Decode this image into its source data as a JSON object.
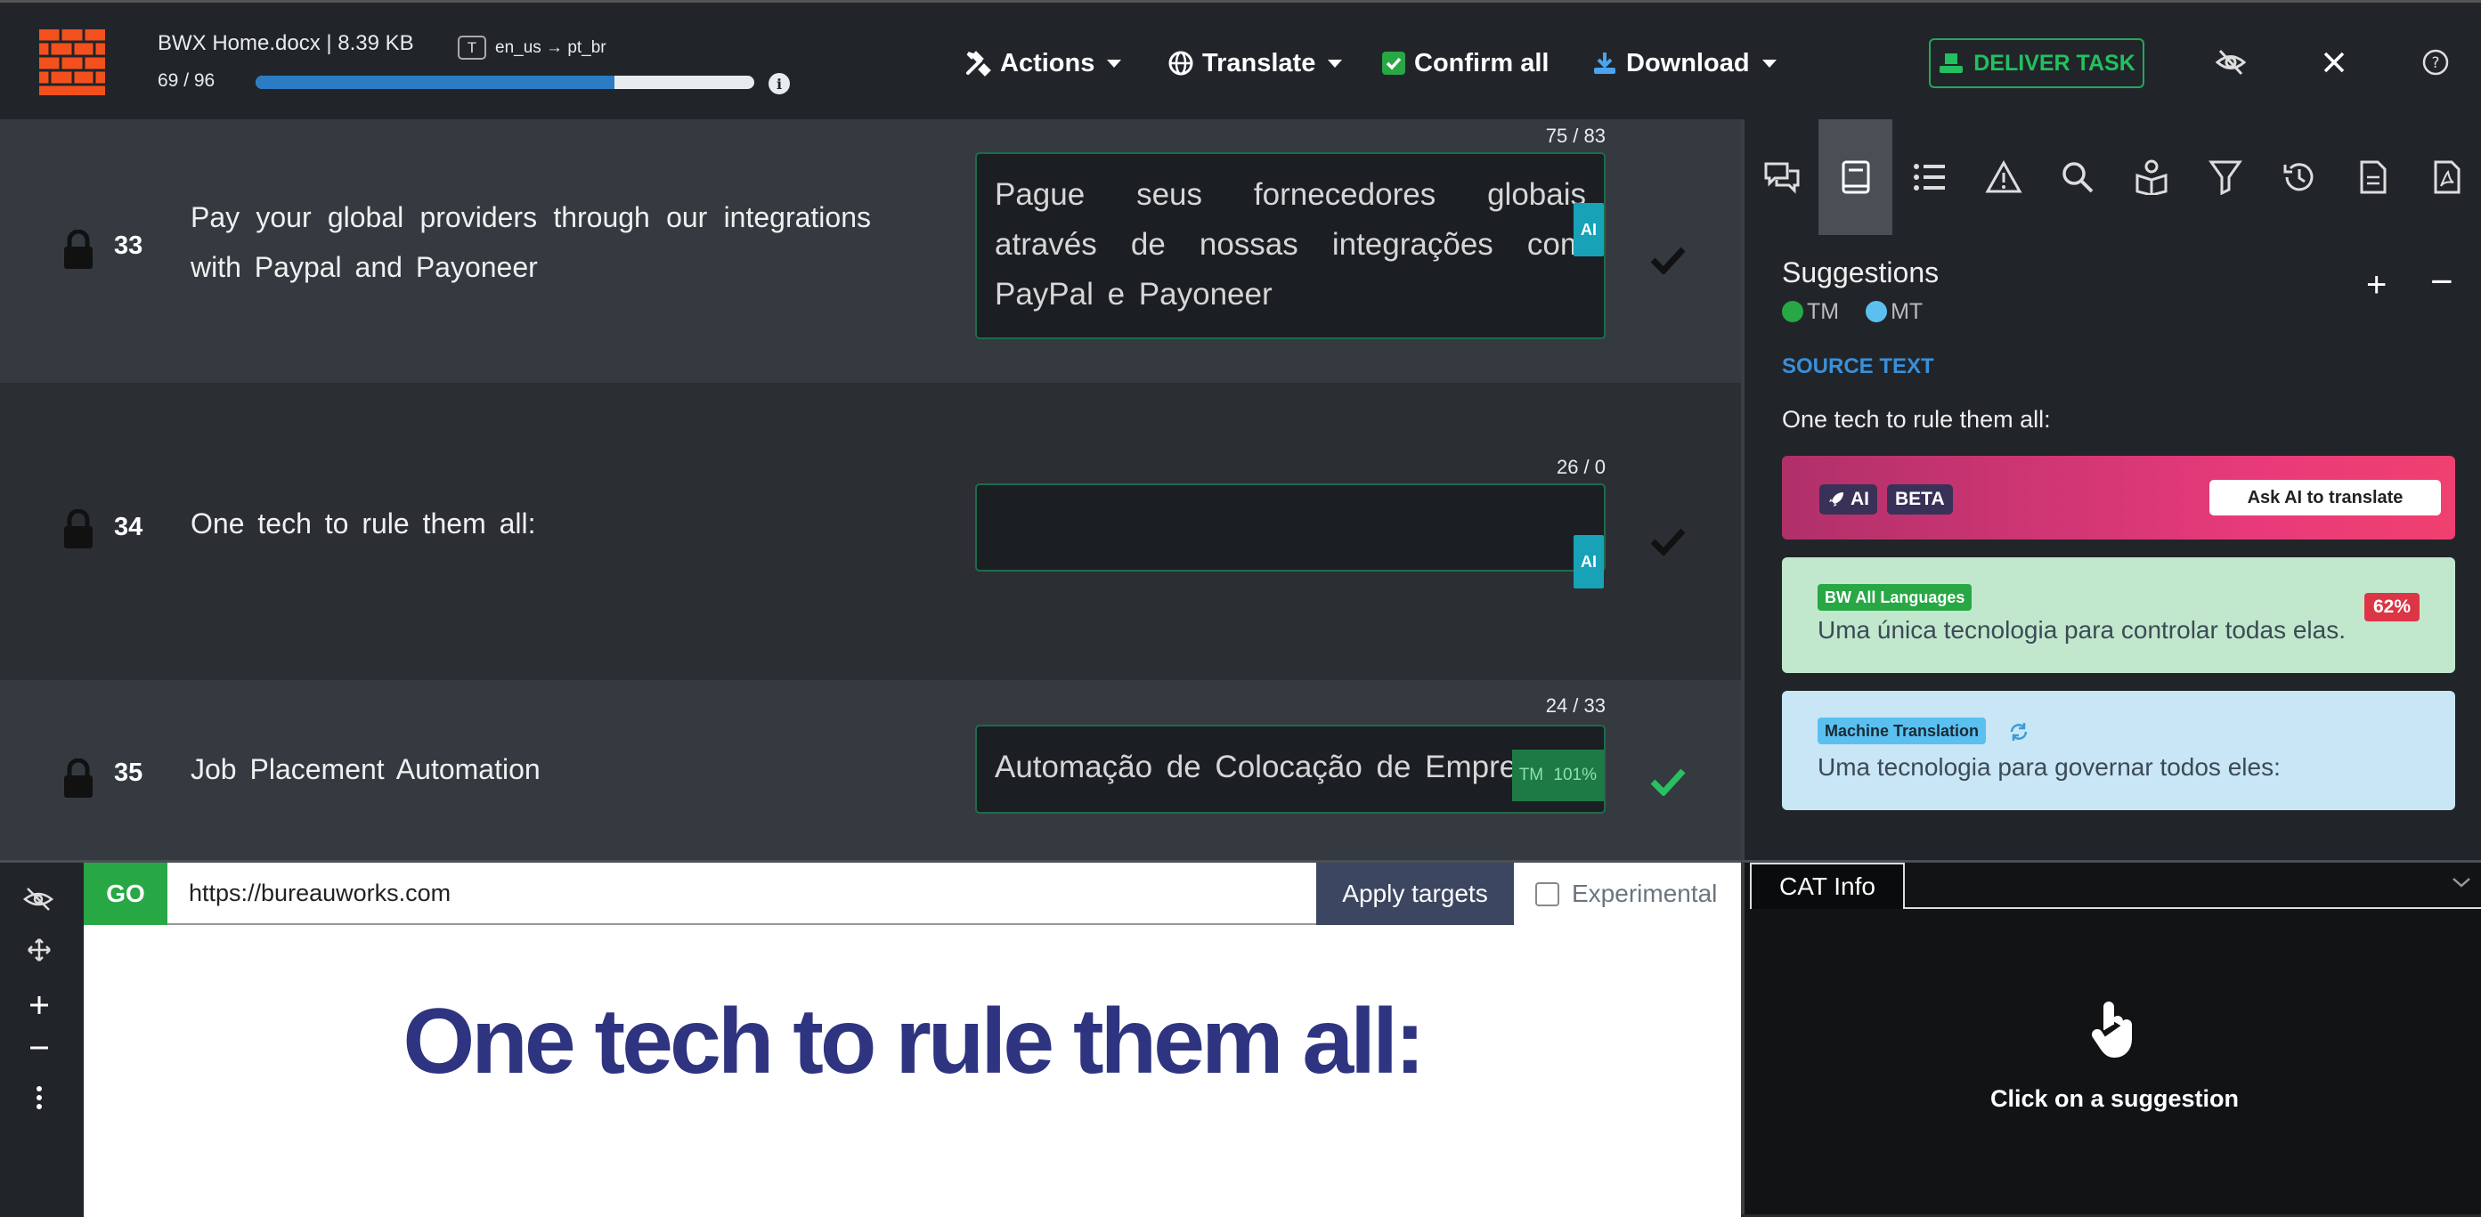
{
  "header": {
    "file_title": "BWX Home.docx | 8.39 KB",
    "lang_pair": "en_us → pt_br",
    "lang_icon": "T",
    "progress_text": "69 / 96",
    "progress_value": 0.72,
    "actions_label": "Actions",
    "translate_label": "Translate",
    "confirm_all_label": "Confirm all",
    "download_label": "Download",
    "deliver_label": "DELIVER TASK"
  },
  "segments": [
    {
      "id": "33",
      "source": "Pay your global providers through our integrations with Paypal and Payoneer",
      "target": "Pague seus fornecedores globais através de nossas integrações com PayPal e Payoneer",
      "counter": "75 / 83",
      "badge": "AI",
      "confirmed": false
    },
    {
      "id": "34",
      "source": "One tech to rule them all:",
      "target": "",
      "counter": "26 / 0",
      "badge": "AI",
      "confirmed": false
    },
    {
      "id": "35",
      "source": "Job Placement Automation",
      "target": "Automação de Colocação de Emprego",
      "counter": "24 / 33",
      "badge": "TM 101%",
      "confirmed": true
    }
  ],
  "panel": {
    "title": "Suggestions",
    "legend_tm": "TM",
    "legend_mt": "MT",
    "plus": "+",
    "minus": "−",
    "source_label": "SOURCE TEXT",
    "source_text": "One tech to rule them all:",
    "ai_pill": "AI",
    "beta_pill": "BETA",
    "ask_ai": "Ask AI to translate",
    "tm_tag": "BW All Languages",
    "tm_text": "Uma única tecnologia para controlar todas elas.",
    "tm_pct": "62%",
    "mt_tag": "Machine Translation",
    "mt_text": "Uma tecnologia para governar todos eles:",
    "colors": {
      "tm": "#28a745",
      "mt": "#5bc0f0",
      "ai_gradient": "#e83a7a"
    }
  },
  "preview": {
    "go_label": "GO",
    "url_value": "https://bureauworks.com",
    "apply_label": "Apply targets",
    "experimental_label": "Experimental",
    "heading": "One tech to rule them all:"
  },
  "cat": {
    "tab_label": "CAT Info",
    "hint": "Click on a suggestion"
  }
}
